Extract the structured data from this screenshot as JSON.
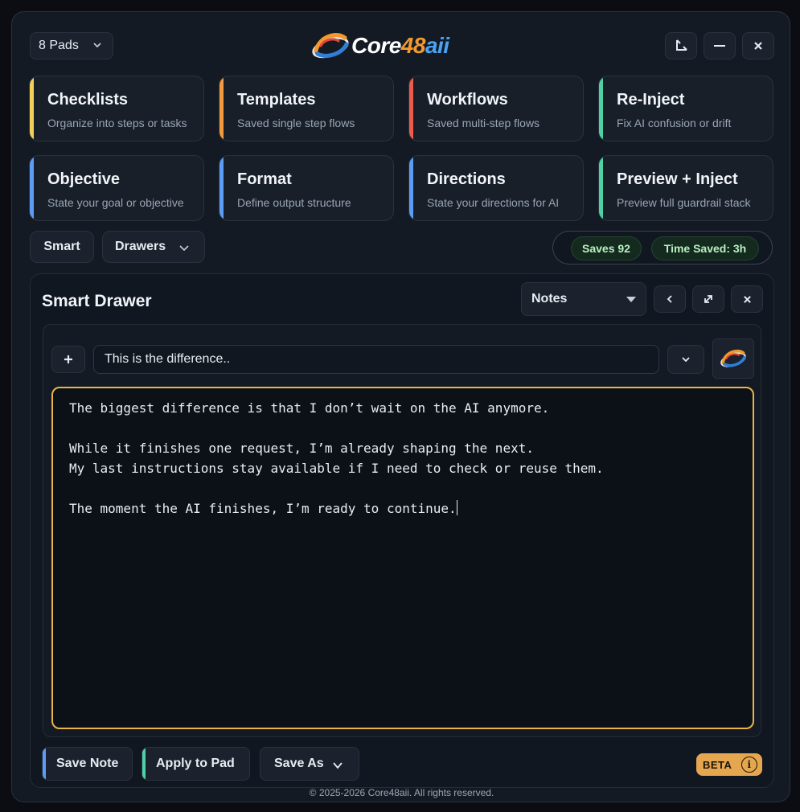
{
  "header": {
    "pads_label": "8 Pads",
    "logo": {
      "part1": "Core",
      "part2": "48",
      "part3": "aii"
    }
  },
  "pads": [
    {
      "title": "Checklists",
      "subtitle": "Organize into steps or tasks",
      "accent": "#f3cf5a"
    },
    {
      "title": "Templates",
      "subtitle": "Saved single step flows",
      "accent": "#f29a3d"
    },
    {
      "title": "Workflows",
      "subtitle": "Saved multi-step flows",
      "accent": "#ef5a4a"
    },
    {
      "title": "Re-Inject",
      "subtitle": "Fix AI confusion or drift",
      "accent": "#4fd1a5"
    },
    {
      "title": "Objective",
      "subtitle": "State your goal or objective",
      "accent": "#5b9df5"
    },
    {
      "title": "Format",
      "subtitle": "Define output structure",
      "accent": "#5b9df5"
    },
    {
      "title": "Directions",
      "subtitle": "State your directions for AI",
      "accent": "#5b9df5"
    },
    {
      "title": "Preview + Inject",
      "subtitle": "Preview full guardrail stack",
      "accent": "#4fd1a5"
    }
  ],
  "controls": {
    "smart_label": "Smart",
    "drawers_label": "Drawers",
    "saves_label": "Saves 92",
    "time_saved_label": "Time Saved: 3h"
  },
  "drawer": {
    "title": "Smart Drawer",
    "mode_selected": "Notes",
    "note_title": "This is the difference..",
    "note_body": "The biggest difference is that I don’t wait on the AI anymore.\n\nWhile it finishes one request, I’m already shaping the next.\nMy last instructions stay available if I need to check or reuse them.\n\nThe moment the AI finishes, I’m ready to continue.",
    "footer": {
      "save_note": "Save Note",
      "apply_to_pad": "Apply to Pad",
      "save_as": "Save As",
      "beta": "BETA",
      "info": "i"
    }
  },
  "copyright": "© 2025-2026 Core48aii. All rights reserved.",
  "colors": {
    "note_border": "#e8b549",
    "accent_blue": "#5b9df5",
    "accent_green": "#4fd1a5"
  }
}
